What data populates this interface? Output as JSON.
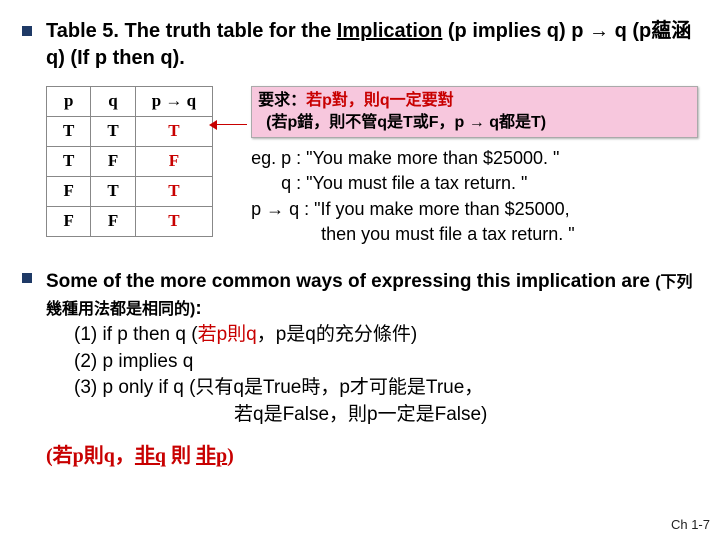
{
  "title": {
    "prefix": "Table 5. The truth table for the ",
    "underlined": "Implication",
    "suffix": " (p implies q) p → q (p蘊涵q) (If p then q)."
  },
  "table": {
    "headers": [
      "p",
      "q",
      "p → q"
    ],
    "rows": [
      [
        "T",
        "T",
        "T"
      ],
      [
        "T",
        "F",
        "F"
      ],
      [
        "F",
        "T",
        "T"
      ],
      [
        "F",
        "F",
        "T"
      ]
    ]
  },
  "highlight": {
    "line1_prefix": "要求：",
    "line1_red": "若p對，則q一定要對",
    "line2": "(若p錯，則不管q是T或F，p → q都是T)"
  },
  "example": {
    "l1": "eg. p : \"You make more than $25000. \"",
    "l2": "      q : \"You must file a tax return. \"",
    "l3": "p → q : \"If you make more than $25000,",
    "l4": "              then you must file a tax return. \""
  },
  "ways": {
    "intro_a": "Some of the more common ways of expressing this implication are ",
    "intro_b": "(下列幾種用法都是相同的)",
    "colon": ":",
    "i1a": "(1) if p then q (",
    "i1red": "若p則q",
    "i1b": "，p是q的充分條件)",
    "i2": "(2) p implies q",
    "i3": "(3) p only if q (只有q是True時，p才可能是True，",
    "i3b": "若q是False，則p一定是False)"
  },
  "contrapositive": {
    "open": "(",
    "a": "若p則q，",
    "nq": "非q",
    "mid": " 則 ",
    "np": "非p",
    "close": ")"
  },
  "footer": "Ch 1-7",
  "chart_data": {
    "type": "table",
    "title": "Truth table for Implication p → q",
    "columns": [
      "p",
      "q",
      "p → q"
    ],
    "rows": [
      [
        "T",
        "T",
        "T"
      ],
      [
        "T",
        "F",
        "F"
      ],
      [
        "F",
        "T",
        "T"
      ],
      [
        "F",
        "F",
        "T"
      ]
    ]
  }
}
